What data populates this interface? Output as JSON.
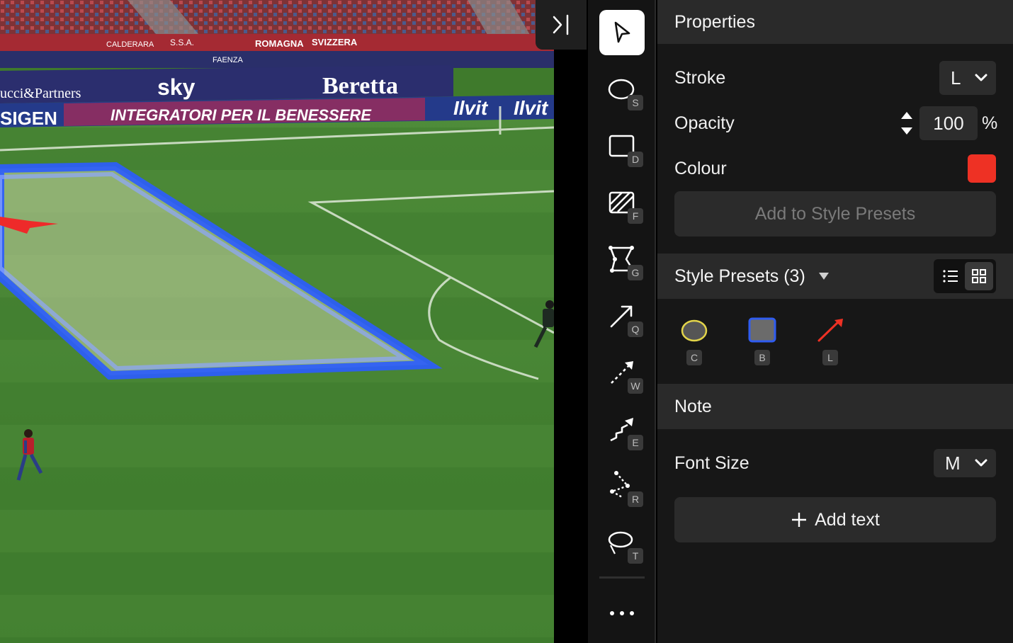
{
  "video": {
    "ad_boards": [
      "sky",
      "Beretta",
      "INTEGRATORI PER IL BENESSERE",
      "SIGEN",
      "ucci&Partners",
      "Ilvit",
      "Ilvit"
    ],
    "small_ads": [
      "ROMAGNA",
      "SVIZZERA",
      "CALDERARA",
      "S.S.A.",
      "FAENZA"
    ]
  },
  "toolbar": {
    "tools": [
      {
        "name": "select-tool",
        "icon": "cursor-arrow-icon",
        "key": ""
      },
      {
        "name": "ellipse-tool",
        "icon": "ellipse-icon",
        "key": "S"
      },
      {
        "name": "rectangle-tool",
        "icon": "rectangle-icon",
        "key": "D"
      },
      {
        "name": "filled-area-tool",
        "icon": "hatched-square-icon",
        "key": "F"
      },
      {
        "name": "polygon-tool",
        "icon": "polygon-icon",
        "key": "G"
      },
      {
        "name": "arrow-tool",
        "icon": "arrow-icon",
        "key": "Q"
      },
      {
        "name": "dashed-arrow-tool",
        "icon": "dashed-arrow-icon",
        "key": "W"
      },
      {
        "name": "dribble-arrow-tool",
        "icon": "zigzag-arrow-icon",
        "key": "E"
      },
      {
        "name": "multi-arrow-tool",
        "icon": "multi-arrow-icon",
        "key": "R"
      },
      {
        "name": "spotlight-tool",
        "icon": "spotlight-icon",
        "key": "T"
      }
    ],
    "more_icon": "more-horizontal-icon"
  },
  "properties": {
    "title": "Properties",
    "stroke_label": "Stroke",
    "stroke_value": "L",
    "opacity_label": "Opacity",
    "opacity_value": "100",
    "opacity_unit": "%",
    "colour_label": "Colour",
    "colour_value": "#ee3124",
    "add_preset_label": "Add to Style Presets"
  },
  "style_presets": {
    "title": "Style Presets (3)",
    "view_modes": [
      "list-view-icon",
      "grid-view-icon"
    ],
    "active_view": "grid",
    "items": [
      {
        "key": "C",
        "shape": "ellipse",
        "fill": "#555555",
        "stroke": "#e2d44a"
      },
      {
        "key": "B",
        "shape": "rectangle",
        "fill": "#6b6b6b",
        "stroke": "#2f5cf0"
      },
      {
        "key": "L",
        "shape": "line",
        "stroke": "#ee3124"
      }
    ]
  },
  "note": {
    "title": "Note",
    "font_size_label": "Font Size",
    "font_size_value": "M",
    "add_text_label": "Add text"
  }
}
